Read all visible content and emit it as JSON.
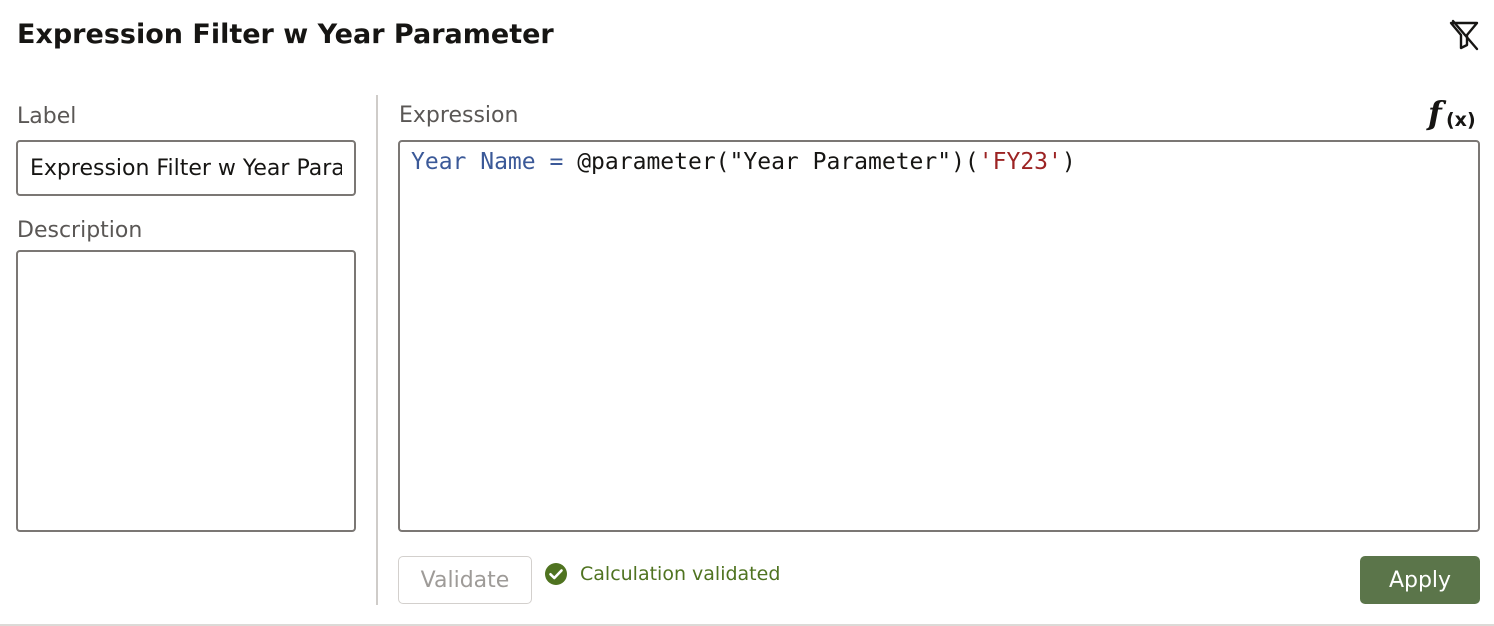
{
  "panel": {
    "title": "Expression Filter w Year Parameter"
  },
  "icons": {
    "clear_filter": "clear-filter-icon",
    "function": "function-fx-icon",
    "check": "check-circle-icon"
  },
  "form": {
    "label_heading": "Label",
    "label_value": "Expression Filter w Year Parameter",
    "description_heading": "Description",
    "description_value": "",
    "expression_heading": "Expression"
  },
  "expression": {
    "column": "Year Name",
    "operator": "=",
    "function": "@parameter(\"Year Parameter\")(",
    "literal": "'FY23'",
    "close": ")"
  },
  "footer": {
    "validate_label": "Validate",
    "status_text": "Calculation validated",
    "apply_label": "Apply"
  },
  "colors": {
    "accent": "#5b754a",
    "success": "#4f7320",
    "keyword": "#3b5998",
    "string": "#9c2323"
  }
}
